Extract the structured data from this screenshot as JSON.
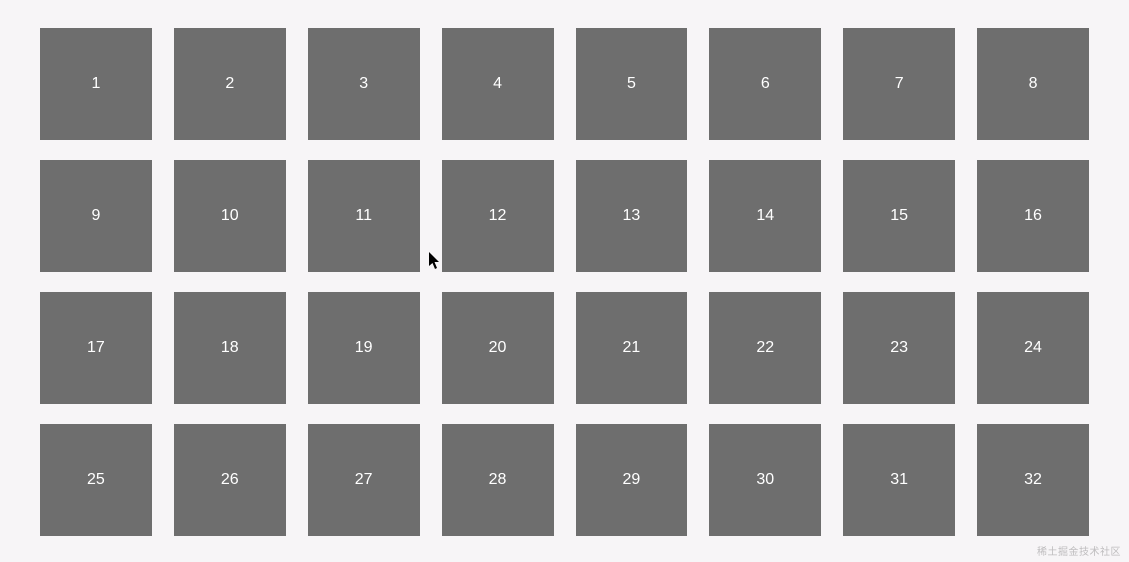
{
  "grid": {
    "items": [
      {
        "label": "1"
      },
      {
        "label": "2"
      },
      {
        "label": "3"
      },
      {
        "label": "4"
      },
      {
        "label": "5"
      },
      {
        "label": "6"
      },
      {
        "label": "7"
      },
      {
        "label": "8"
      },
      {
        "label": "9"
      },
      {
        "label": "10"
      },
      {
        "label": "11"
      },
      {
        "label": "12"
      },
      {
        "label": "13"
      },
      {
        "label": "14"
      },
      {
        "label": "15"
      },
      {
        "label": "16"
      },
      {
        "label": "17"
      },
      {
        "label": "18"
      },
      {
        "label": "19"
      },
      {
        "label": "20"
      },
      {
        "label": "21"
      },
      {
        "label": "22"
      },
      {
        "label": "23"
      },
      {
        "label": "24"
      },
      {
        "label": "25"
      },
      {
        "label": "26"
      },
      {
        "label": "27"
      },
      {
        "label": "28"
      },
      {
        "label": "29"
      },
      {
        "label": "30"
      },
      {
        "label": "31"
      },
      {
        "label": "32"
      }
    ]
  },
  "watermark": "稀土掘金技术社区"
}
